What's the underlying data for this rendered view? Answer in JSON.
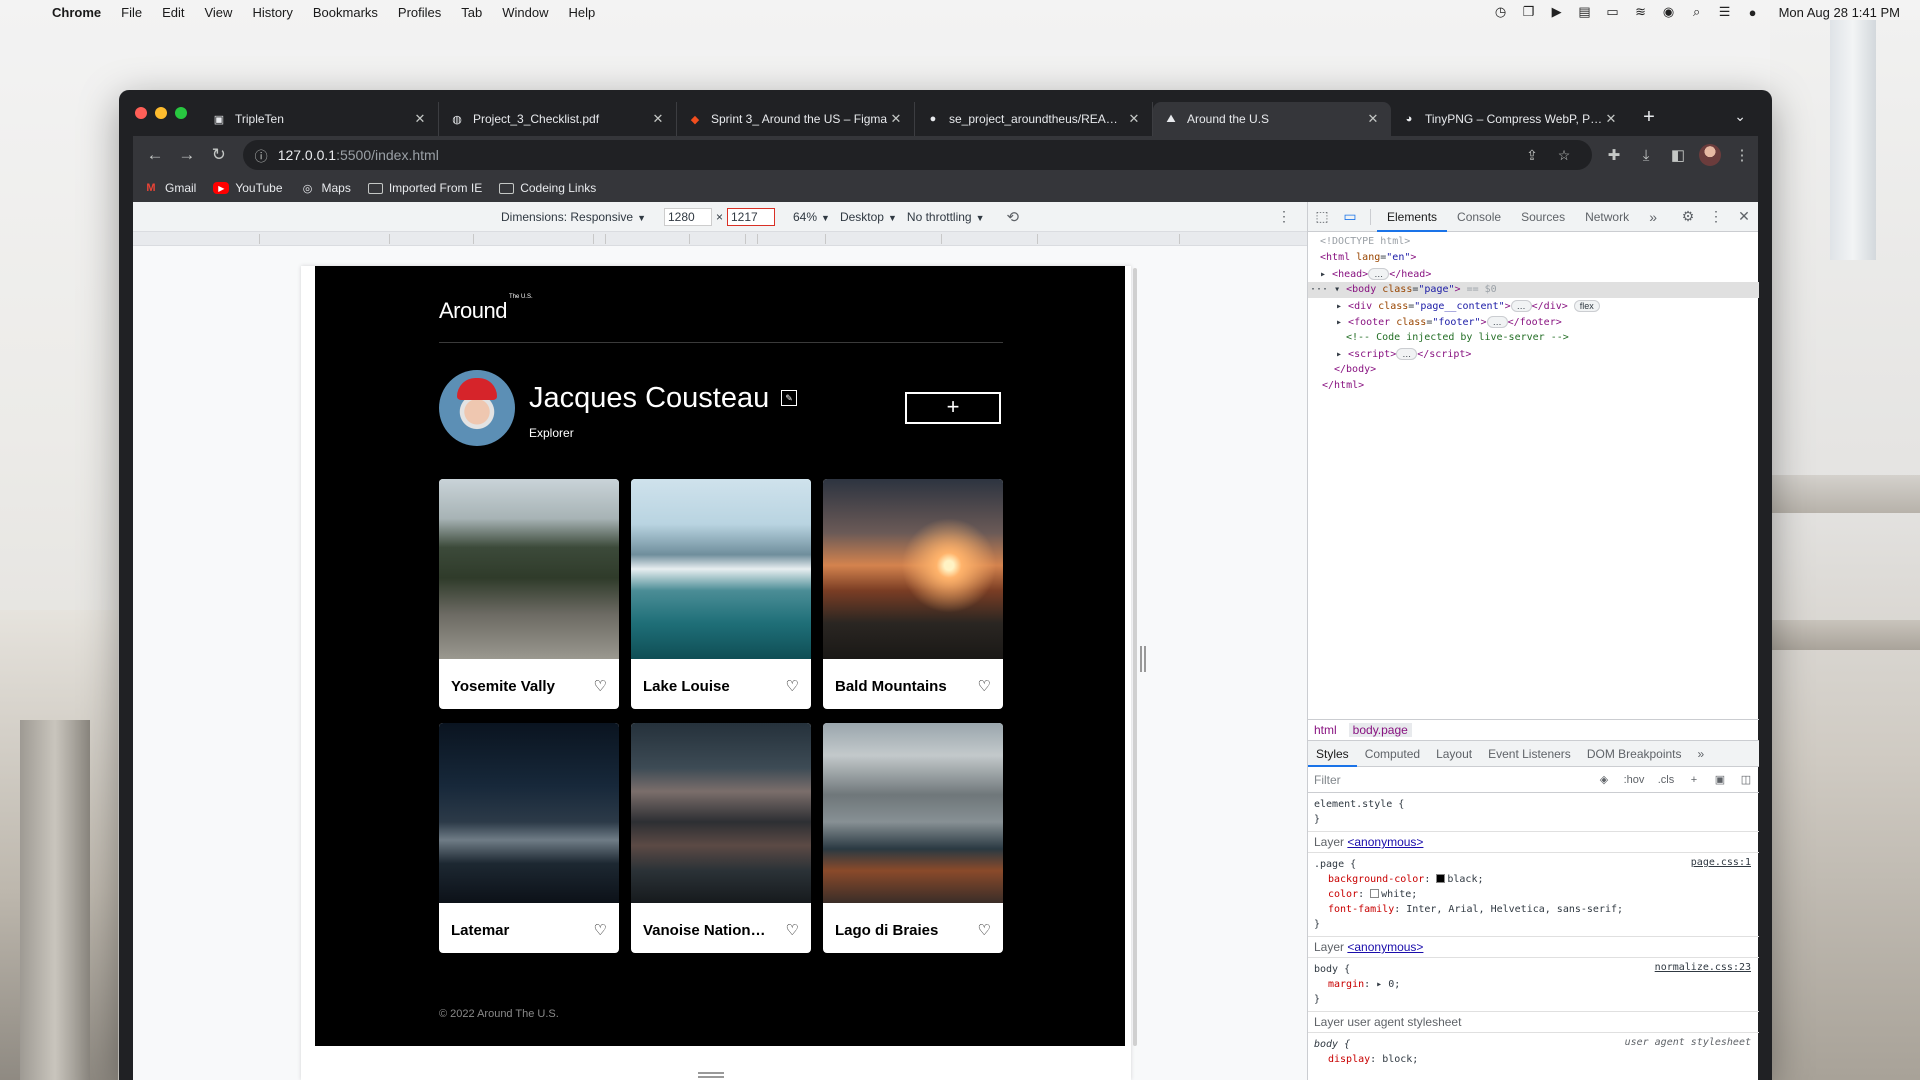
{
  "menubar": {
    "app": "Chrome",
    "items": [
      "File",
      "Edit",
      "View",
      "History",
      "Bookmarks",
      "Profiles",
      "Tab",
      "Window",
      "Help"
    ],
    "clock": "Mon Aug 28  1:41 PM"
  },
  "tabs": [
    {
      "title": "TripleTen",
      "icon": "tripleten-icon"
    },
    {
      "title": "Project_3_Checklist.pdf",
      "icon": "globe-icon"
    },
    {
      "title": "Sprint 3_ Around the US – Figma",
      "icon": "figma-icon"
    },
    {
      "title": "se_project_aroundtheus/README",
      "icon": "github-icon"
    },
    {
      "title": "Around the U.S",
      "icon": "page-icon",
      "active": true
    },
    {
      "title": "TinyPNG – Compress WebP, PNG",
      "icon": "tinypng-icon"
    }
  ],
  "address": {
    "host": "127.0.0.1",
    "path": ":5500/index.html"
  },
  "bookmarks": [
    {
      "label": "Gmail",
      "icon": "gmail-icon"
    },
    {
      "label": "YouTube",
      "icon": "youtube-icon"
    },
    {
      "label": "Maps",
      "icon": "maps-icon"
    },
    {
      "label": "Imported From IE",
      "icon": "folder-icon"
    },
    {
      "label": "Codeing Links",
      "icon": "folder-icon"
    }
  ],
  "device_toolbar": {
    "dimensions": "Dimensions: Responsive",
    "width": "1280",
    "height": "1217",
    "zoom": "64%",
    "device_type": "Desktop",
    "throttling": "No throttling"
  },
  "page": {
    "logo": "Around",
    "logo_sup": "The U.S.",
    "profile_name": "Jacques Cousteau",
    "profile_job": "Explorer",
    "add_label": "+",
    "cards": [
      {
        "title": "Yosemite Vally",
        "image": "img-yosemite"
      },
      {
        "title": "Lake Louise",
        "image": "img-louise"
      },
      {
        "title": "Bald Mountains",
        "image": "img-bald"
      },
      {
        "title": "Latemar",
        "image": "img-latemar"
      },
      {
        "title": "Vanoise National Park",
        "image": "img-vanoise"
      },
      {
        "title": "Lago di Braies",
        "image": "img-braies"
      }
    ],
    "footer": "© 2022 Around The U.S."
  },
  "devtools": {
    "tabs": [
      "Elements",
      "Console",
      "Sources",
      "Network"
    ],
    "active_tab": "Elements",
    "dom": {
      "doctype": "<!DOCTYPE html>",
      "html_open": "html",
      "html_attr": "lang",
      "html_val": "\"en\"",
      "head": "head",
      "body_attr_val": "\"page\"",
      "body_eq": "== $0",
      "div_val": "\"page__content\"",
      "flex_badge": "flex",
      "footer_val": "\"footer\"",
      "comment": "<!-- Code injected by live-server -->",
      "script": "script"
    },
    "breadcrumbs": [
      "html",
      "body.page"
    ],
    "style_tabs": [
      "Styles",
      "Computed",
      "Layout",
      "Event Listeners",
      "DOM Breakpoints"
    ],
    "filter_placeholder": "Filter",
    "filter_hov": ":hov",
    "filter_cls": ".cls",
    "rules": {
      "element_style": "element.style {",
      "layer_label": "Layer",
      "layer_anon": "<anonymous>",
      "page_selector": ".page {",
      "page_source": "page.css:1",
      "page_bg_prop": "background-color",
      "page_bg_val": "black;",
      "page_color_prop": "color",
      "page_color_val": "white;",
      "page_font_prop": "font-family",
      "page_font_val": "Inter, Arial, Helvetica, sans-serif;",
      "body_selector": "body {",
      "body_source": "normalize.css:23",
      "body_margin_prop": "margin",
      "body_margin_val": "0;",
      "ua_header": "Layer user agent stylesheet",
      "ua_source": "user agent stylesheet",
      "ua_display_prop": "display",
      "ua_display_val": "block;"
    }
  }
}
